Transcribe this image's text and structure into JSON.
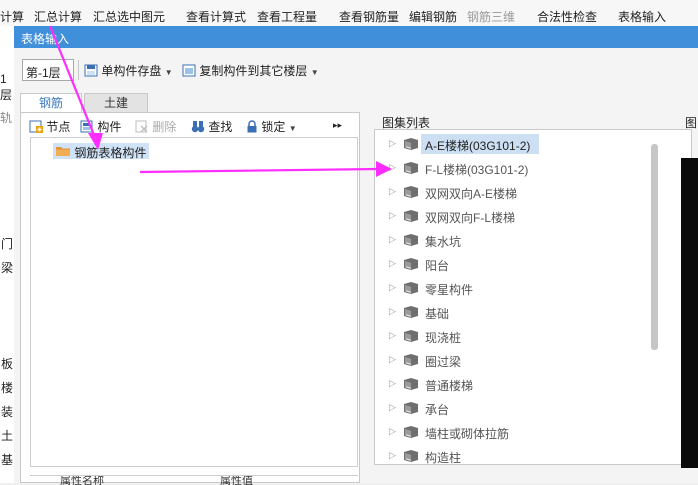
{
  "app_toolbar": {
    "items": [
      "计算",
      "汇总计算",
      "汇总选中图元",
      "查看计算式",
      "查看工程量",
      "查看钢筋量",
      "编辑钢筋",
      "钢筋三维",
      "合法性检查",
      "表格输入"
    ]
  },
  "left_strip": {
    "floor_fragment": "1层",
    "tab_fragment": "轨",
    "chars": [
      "门",
      "梁",
      "板",
      "楼",
      "装",
      "土",
      "基"
    ]
  },
  "dialog": {
    "title": "表格输入",
    "toolbar": {
      "floor_value": "第-1层",
      "save_component": "单构件存盘",
      "copy_to_floors": "复制构件到其它楼层"
    },
    "tabs": [
      {
        "label": "钢筋",
        "active": true
      },
      {
        "label": "土建",
        "active": false
      }
    ],
    "tree_toolbar": {
      "node": "节点",
      "component": "构件",
      "delete": "删除",
      "find": "查找",
      "lock": "锁定"
    },
    "tree_node": "钢筋表格构件",
    "props_headers": [
      "属性名称",
      "属性值"
    ],
    "atlas": {
      "title": "图集列表",
      "items": [
        {
          "label": "A-E楼梯(03G101-2)",
          "selected": true
        },
        {
          "label": "F-L楼梯(03G101-2)",
          "selected": false
        },
        {
          "label": "双网双向A-E楼梯",
          "selected": false
        },
        {
          "label": "双网双向F-L楼梯",
          "selected": false
        },
        {
          "label": "集水坑",
          "selected": false
        },
        {
          "label": "阳台",
          "selected": false
        },
        {
          "label": "零星构件",
          "selected": false
        },
        {
          "label": "基础",
          "selected": false
        },
        {
          "label": "现浇桩",
          "selected": false
        },
        {
          "label": "圈过梁",
          "selected": false
        },
        {
          "label": "普通楼梯",
          "selected": false
        },
        {
          "label": "承台",
          "selected": false
        },
        {
          "label": "墙柱或砌体拉筋",
          "selected": false
        },
        {
          "label": "构造柱",
          "selected": false
        }
      ]
    },
    "right_label": "图"
  },
  "colors": {
    "title_bar": "#3f8fdb",
    "arrow": "#ff2cff",
    "selection": "#cde0f3",
    "tab_active_text": "#3a78c2"
  }
}
